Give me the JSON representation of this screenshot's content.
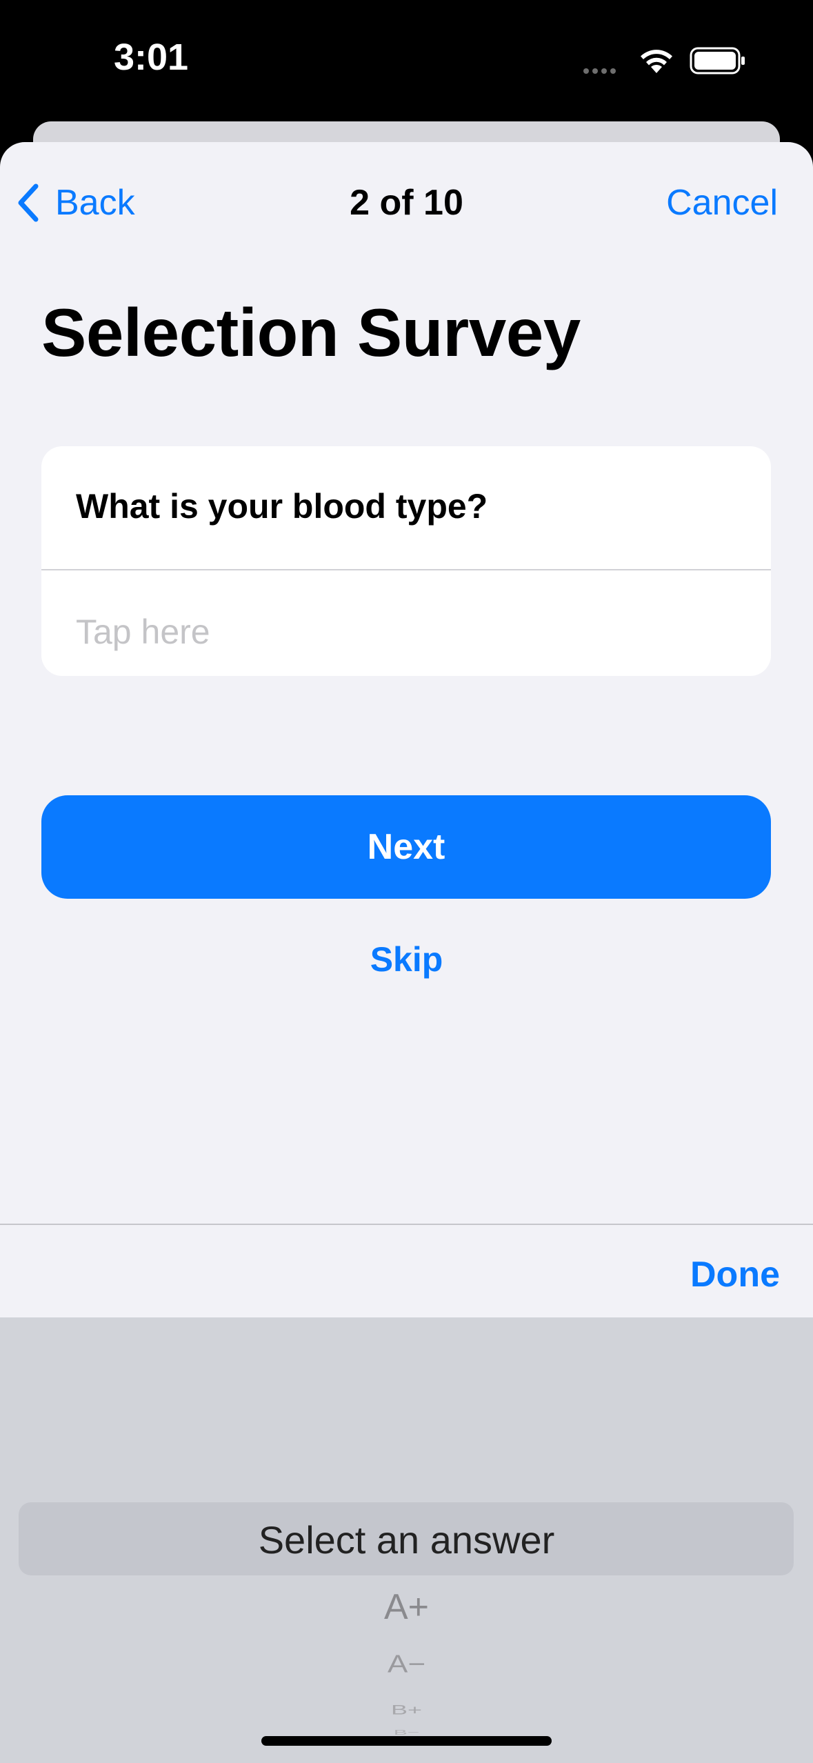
{
  "status_bar": {
    "time": "3:01",
    "icons": [
      "cellular-dots-icon",
      "wifi-icon",
      "battery-icon"
    ]
  },
  "nav": {
    "back_label": "Back",
    "progress": "2 of 10",
    "cancel_label": "Cancel"
  },
  "survey": {
    "title": "Selection Survey",
    "question": "What is your blood type?",
    "answer_placeholder": "Tap here"
  },
  "actions": {
    "next_label": "Next",
    "skip_label": "Skip"
  },
  "toolbar": {
    "done_label": "Done"
  },
  "picker": {
    "selected": "Select an answer",
    "options": [
      "A+",
      "A−",
      "B+",
      "B−"
    ]
  },
  "colors": {
    "accent": "#0a7aff",
    "background": "#f2f2f7",
    "picker_background": "#d1d3d9"
  }
}
